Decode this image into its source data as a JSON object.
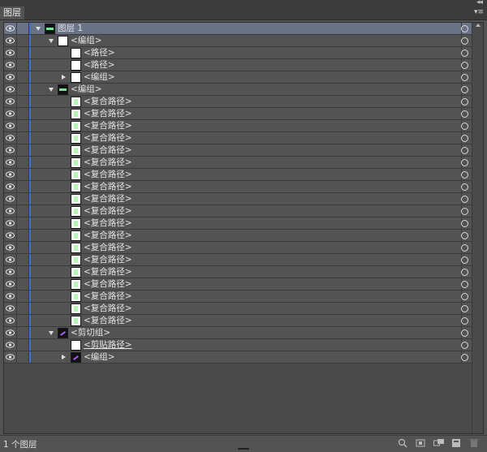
{
  "panel": {
    "tab_label": "图层",
    "collapse_glyph": "◂◂",
    "menu_glyph": "▾≡",
    "footer_count": "1 个图层",
    "accent_color": "#3f6fd8",
    "selected_row_color": "#6a7288"
  },
  "rows": [
    {
      "level": 0,
      "tri": "open",
      "thumb": "banner",
      "label": "图层 1",
      "selected": true
    },
    {
      "level": 1,
      "tri": "open",
      "thumb": "white",
      "label": "<编组>"
    },
    {
      "level": 2,
      "tri": "",
      "thumb": "white",
      "label": "<路径>"
    },
    {
      "level": 2,
      "tri": "",
      "thumb": "white",
      "label": "<路径>"
    },
    {
      "level": 2,
      "tri": "closed",
      "thumb": "white",
      "label": "<编组>"
    },
    {
      "level": 1,
      "tri": "open",
      "thumb": "banner",
      "label": "<编组>"
    },
    {
      "level": 2,
      "tri": "",
      "thumb": "green",
      "label": "<复合路径>"
    },
    {
      "level": 2,
      "tri": "",
      "thumb": "green",
      "label": "<复合路径>"
    },
    {
      "level": 2,
      "tri": "",
      "thumb": "green",
      "label": "<复合路径>"
    },
    {
      "level": 2,
      "tri": "",
      "thumb": "green",
      "label": "<复合路径>"
    },
    {
      "level": 2,
      "tri": "",
      "thumb": "green",
      "label": "<复合路径>"
    },
    {
      "level": 2,
      "tri": "",
      "thumb": "green",
      "label": "<复合路径>"
    },
    {
      "level": 2,
      "tri": "",
      "thumb": "green",
      "label": "<复合路径>"
    },
    {
      "level": 2,
      "tri": "",
      "thumb": "green",
      "label": "<复合路径>"
    },
    {
      "level": 2,
      "tri": "",
      "thumb": "green",
      "label": "<复合路径>"
    },
    {
      "level": 2,
      "tri": "",
      "thumb": "green",
      "label": "<复合路径>"
    },
    {
      "level": 2,
      "tri": "",
      "thumb": "green",
      "label": "<复合路径>"
    },
    {
      "level": 2,
      "tri": "",
      "thumb": "green",
      "label": "<复合路径>"
    },
    {
      "level": 2,
      "tri": "",
      "thumb": "green",
      "label": "<复合路径>"
    },
    {
      "level": 2,
      "tri": "",
      "thumb": "green",
      "label": "<复合路径>"
    },
    {
      "level": 2,
      "tri": "",
      "thumb": "green",
      "label": "<复合路径>"
    },
    {
      "level": 2,
      "tri": "",
      "thumb": "green",
      "label": "<复合路径>"
    },
    {
      "level": 2,
      "tri": "",
      "thumb": "green",
      "label": "<复合路径>"
    },
    {
      "level": 2,
      "tri": "",
      "thumb": "green",
      "label": "<复合路径>"
    },
    {
      "level": 2,
      "tri": "",
      "thumb": "green",
      "label": "<复合路径>"
    },
    {
      "level": 1,
      "tri": "open",
      "thumb": "purple",
      "label": "<剪切组>"
    },
    {
      "level": 2,
      "tri": "",
      "thumb": "white",
      "label": "<剪贴路径>",
      "underline": true
    },
    {
      "level": 2,
      "tri": "closed",
      "thumb": "purple",
      "label": "<编组>"
    }
  ]
}
